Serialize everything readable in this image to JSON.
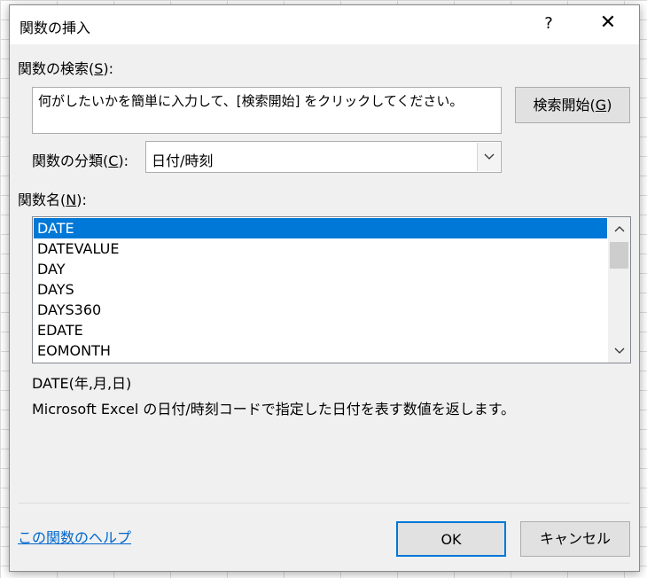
{
  "dialog": {
    "title": "関数の挿入",
    "help_glyph": "?",
    "close_glyph": "✕"
  },
  "search": {
    "label": "関数の検索(",
    "label_key": "S",
    "label_end": "):",
    "text": "何がしたいかを簡単に入力して、[検索開始] をクリックしてください。",
    "button_label": "検索開始(",
    "button_key": "G",
    "button_end": ")"
  },
  "category": {
    "label": "関数の分類(",
    "label_key": "C",
    "label_end": "):",
    "selected": "日付/時刻"
  },
  "function_list": {
    "label": "関数名(",
    "label_key": "N",
    "label_end": "):",
    "items": [
      "DATE",
      "DATEVALUE",
      "DAY",
      "DAYS",
      "DAYS360",
      "EDATE",
      "EOMONTH"
    ],
    "selected_index": 0
  },
  "description": {
    "signature": "DATE(年,月,日)",
    "text": "Microsoft Excel の日付/時刻コードで指定した日付を表す数値を返します。"
  },
  "footer": {
    "help_link": "この関数のヘルプ",
    "ok_label": "OK",
    "cancel_label": "キャンセル"
  },
  "colors": {
    "selection": "#0078d7",
    "link": "#0066cc",
    "dialog_bg": "#f0f0f0"
  },
  "icons": {
    "dropdown": "chevron-down-icon",
    "scroll_up": "chevron-up-icon",
    "scroll_down": "chevron-down-icon"
  }
}
